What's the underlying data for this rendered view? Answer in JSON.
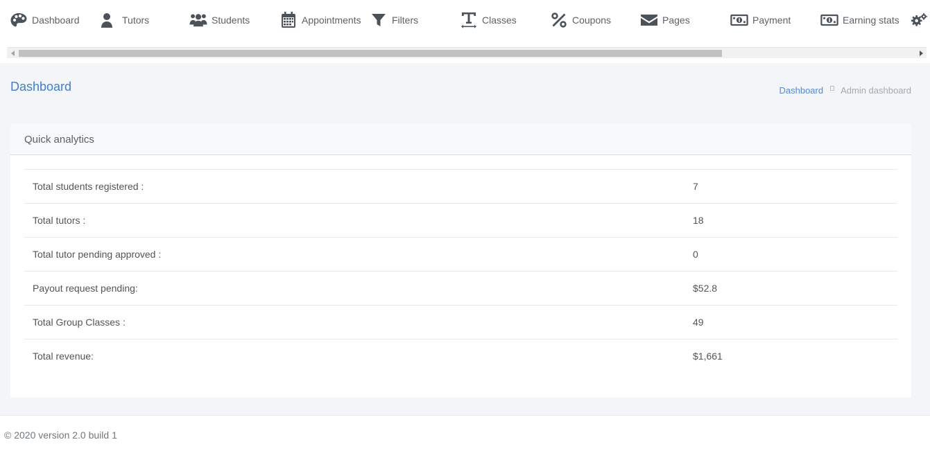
{
  "nav": {
    "items": [
      {
        "label": "Dashboard",
        "icon": "palette-icon"
      },
      {
        "label": "Tutors",
        "icon": "user-icon"
      },
      {
        "label": "Students",
        "icon": "users-icon"
      },
      {
        "label": "Appointments",
        "icon": "calendar-icon"
      },
      {
        "label": "Filters",
        "icon": "filter-icon"
      },
      {
        "label": "Classes",
        "icon": "text-width-icon"
      },
      {
        "label": "Coupons",
        "icon": "percent-icon"
      },
      {
        "label": "Pages",
        "icon": "envelope-icon"
      },
      {
        "label": "Payment",
        "icon": "money-bill-icon"
      },
      {
        "label": "Earning stats",
        "icon": "money-bill-icon"
      }
    ],
    "settings_icon": "gears-icon",
    "icon_color": "#4c5259"
  },
  "page": {
    "title": "Dashboard",
    "breadcrumb": {
      "link": "Dashboard",
      "current": "Admin dashboard"
    }
  },
  "analytics": {
    "heading": "Quick analytics",
    "rows": [
      {
        "label": "Total students registered :",
        "value": "7"
      },
      {
        "label": "Total tutors :",
        "value": "18"
      },
      {
        "label": "Total tutor pending approved :",
        "value": "0"
      },
      {
        "label": "Payout request pending:",
        "value": "$52.8"
      },
      {
        "label": "Total Group Classes :",
        "value": "49"
      },
      {
        "label": "Total revenue:",
        "value": "$1,661"
      }
    ]
  },
  "footer": {
    "text": "© 2020 version 2.0 build 1"
  },
  "colors": {
    "accent": "#3f7fcc",
    "page_bg": "#f3f5f8"
  }
}
